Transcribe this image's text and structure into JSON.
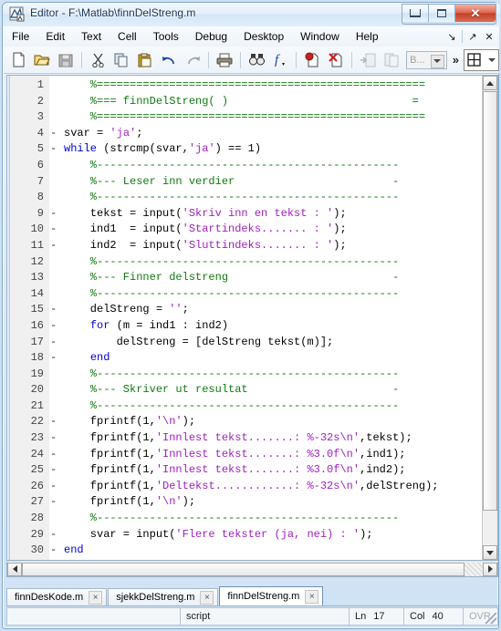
{
  "window": {
    "title": "Editor - F:\\Matlab\\finnDelStreng.m",
    "icon": "matlab-editor-icon",
    "minimize_label": "Minimize",
    "maximize_label": "Maximize",
    "close_label": "Close"
  },
  "menu": {
    "items": [
      {
        "label": "File"
      },
      {
        "label": "Edit"
      },
      {
        "label": "Text"
      },
      {
        "label": "Cell"
      },
      {
        "label": "Tools"
      },
      {
        "label": "Debug"
      },
      {
        "label": "Desktop"
      },
      {
        "label": "Window"
      },
      {
        "label": "Help"
      }
    ],
    "right": [
      {
        "name": "dock-arrow-icon",
        "glyph": "↘"
      },
      {
        "name": "undock-arrow-icon",
        "glyph": "↗"
      },
      {
        "name": "close-icon",
        "glyph": "✕"
      }
    ]
  },
  "toolbar": {
    "buttons": [
      {
        "name": "new-file-icon",
        "title": "New"
      },
      {
        "name": "open-file-icon",
        "title": "Open"
      },
      {
        "name": "save-icon",
        "title": "Save"
      },
      {
        "name": "cut-icon",
        "title": "Cut"
      },
      {
        "name": "copy-icon",
        "title": "Copy"
      },
      {
        "name": "paste-icon",
        "title": "Paste"
      },
      {
        "name": "undo-icon",
        "title": "Undo"
      },
      {
        "name": "redo-icon",
        "title": "Redo"
      },
      {
        "name": "print-icon",
        "title": "Print"
      },
      {
        "name": "find-icon",
        "title": "Find"
      },
      {
        "name": "function-browser-icon",
        "title": "Function"
      },
      {
        "name": "set-breakpoint-icon",
        "title": "Set/Clear Breakpoint"
      },
      {
        "name": "clear-breakpoints-icon",
        "title": "Clear All Breakpoints"
      },
      {
        "name": "step-in-icon",
        "title": "Step In"
      },
      {
        "name": "step-out-icon",
        "title": "Step Out"
      }
    ],
    "stack_dropdown_value": "B...",
    "overflow_label": "»",
    "layout_label": "Layout"
  },
  "editor": {
    "lines": [
      {
        "num": "1",
        "mark": "",
        "tokens": [
          {
            "t": "cm",
            "v": "    %=================================================="
          }
        ]
      },
      {
        "num": "2",
        "mark": "",
        "tokens": [
          {
            "t": "cm",
            "v": "    %=== finnDelStreng( )                            ="
          }
        ]
      },
      {
        "num": "3",
        "mark": "",
        "tokens": [
          {
            "t": "cm",
            "v": "    %=================================================="
          }
        ]
      },
      {
        "num": "4",
        "mark": "-",
        "tokens": [
          {
            "t": "pl",
            "v": "svar = "
          },
          {
            "t": "st",
            "v": "'ja'"
          },
          {
            "t": "pl",
            "v": ";"
          }
        ]
      },
      {
        "num": "5",
        "mark": "-",
        "tokens": [
          {
            "t": "kw",
            "v": "while"
          },
          {
            "t": "pl",
            "v": " (strcmp(svar,"
          },
          {
            "t": "st",
            "v": "'ja'"
          },
          {
            "t": "pl",
            "v": ") == 1)"
          }
        ]
      },
      {
        "num": "6",
        "mark": "",
        "tokens": [
          {
            "t": "cm",
            "v": "    %----------------------------------------------"
          }
        ]
      },
      {
        "num": "7",
        "mark": "",
        "tokens": [
          {
            "t": "cm",
            "v": "    %--- Leser inn verdier                        -"
          }
        ]
      },
      {
        "num": "8",
        "mark": "",
        "tokens": [
          {
            "t": "cm",
            "v": "    %----------------------------------------------"
          }
        ]
      },
      {
        "num": "9",
        "mark": "-",
        "tokens": [
          {
            "t": "pl",
            "v": "    tekst = input("
          },
          {
            "t": "st",
            "v": "'Skriv inn en tekst : '"
          },
          {
            "t": "pl",
            "v": ");"
          }
        ]
      },
      {
        "num": "10",
        "mark": "-",
        "tokens": [
          {
            "t": "pl",
            "v": "    ind1  = input("
          },
          {
            "t": "st",
            "v": "'Startindeks....... : '"
          },
          {
            "t": "pl",
            "v": ");"
          }
        ]
      },
      {
        "num": "11",
        "mark": "-",
        "tokens": [
          {
            "t": "pl",
            "v": "    ind2  = input("
          },
          {
            "t": "st",
            "v": "'Sluttindeks....... : '"
          },
          {
            "t": "pl",
            "v": ");"
          }
        ]
      },
      {
        "num": "12",
        "mark": "",
        "tokens": [
          {
            "t": "cm",
            "v": "    %----------------------------------------------"
          }
        ]
      },
      {
        "num": "13",
        "mark": "",
        "tokens": [
          {
            "t": "cm",
            "v": "    %--- Finner delstreng                         -"
          }
        ]
      },
      {
        "num": "14",
        "mark": "",
        "tokens": [
          {
            "t": "cm",
            "v": "    %----------------------------------------------"
          }
        ]
      },
      {
        "num": "15",
        "mark": "-",
        "tokens": [
          {
            "t": "pl",
            "v": "    delStreng = "
          },
          {
            "t": "st",
            "v": "''"
          },
          {
            "t": "pl",
            "v": ";"
          }
        ]
      },
      {
        "num": "16",
        "mark": "-",
        "tokens": [
          {
            "t": "pl",
            "v": "    "
          },
          {
            "t": "kw",
            "v": "for"
          },
          {
            "t": "pl",
            "v": " (m = ind1 : ind2)"
          }
        ]
      },
      {
        "num": "17",
        "mark": "-",
        "tokens": [
          {
            "t": "pl",
            "v": "        delStreng = [delStreng tekst(m)];"
          }
        ]
      },
      {
        "num": "18",
        "mark": "-",
        "tokens": [
          {
            "t": "pl",
            "v": "    "
          },
          {
            "t": "kw",
            "v": "end"
          }
        ]
      },
      {
        "num": "19",
        "mark": "",
        "tokens": [
          {
            "t": "cm",
            "v": "    %----------------------------------------------"
          }
        ]
      },
      {
        "num": "20",
        "mark": "",
        "tokens": [
          {
            "t": "cm",
            "v": "    %--- Skriver ut resultat                      -"
          }
        ]
      },
      {
        "num": "21",
        "mark": "",
        "tokens": [
          {
            "t": "cm",
            "v": "    %----------------------------------------------"
          }
        ]
      },
      {
        "num": "22",
        "mark": "-",
        "tokens": [
          {
            "t": "pl",
            "v": "    fprintf(1,"
          },
          {
            "t": "st",
            "v": "'\\n'"
          },
          {
            "t": "pl",
            "v": ");"
          }
        ]
      },
      {
        "num": "23",
        "mark": "-",
        "tokens": [
          {
            "t": "pl",
            "v": "    fprintf(1,"
          },
          {
            "t": "st",
            "v": "'Innlest tekst.......: %-32s\\n'"
          },
          {
            "t": "pl",
            "v": ",tekst);"
          }
        ]
      },
      {
        "num": "24",
        "mark": "-",
        "tokens": [
          {
            "t": "pl",
            "v": "    fprintf(1,"
          },
          {
            "t": "st",
            "v": "'Innlest tekst.......: %3.0f\\n'"
          },
          {
            "t": "pl",
            "v": ",ind1);"
          }
        ]
      },
      {
        "num": "25",
        "mark": "-",
        "tokens": [
          {
            "t": "pl",
            "v": "    fprintf(1,"
          },
          {
            "t": "st",
            "v": "'Innlest tekst.......: %3.0f\\n'"
          },
          {
            "t": "pl",
            "v": ",ind2);"
          }
        ]
      },
      {
        "num": "26",
        "mark": "-",
        "tokens": [
          {
            "t": "pl",
            "v": "    fprintf(1,"
          },
          {
            "t": "st",
            "v": "'Deltekst............: %-32s\\n'"
          },
          {
            "t": "pl",
            "v": ",delStreng);"
          }
        ]
      },
      {
        "num": "27",
        "mark": "-",
        "tokens": [
          {
            "t": "pl",
            "v": "    fprintf(1,"
          },
          {
            "t": "st",
            "v": "'\\n'"
          },
          {
            "t": "pl",
            "v": ");"
          }
        ]
      },
      {
        "num": "28",
        "mark": "",
        "tokens": [
          {
            "t": "cm",
            "v": "    %----------------------------------------------"
          }
        ]
      },
      {
        "num": "29",
        "mark": "-",
        "tokens": [
          {
            "t": "pl",
            "v": "    svar = input("
          },
          {
            "t": "st",
            "v": "'Flere tekster (ja, nei) : '"
          },
          {
            "t": "pl",
            "v": ");"
          }
        ]
      },
      {
        "num": "30",
        "mark": "-",
        "tokens": [
          {
            "t": "kw",
            "v": "end"
          }
        ]
      }
    ]
  },
  "tabs": [
    {
      "label": "finnDesKode.m",
      "active": false,
      "close": "×"
    },
    {
      "label": "sjekkDelStreng.m",
      "active": false,
      "close": "×"
    },
    {
      "label": "finnDelStreng.m",
      "active": true,
      "close": "×"
    }
  ],
  "status": {
    "file_type": "script",
    "line_label": "Ln",
    "line_value": "17",
    "col_label": "Col",
    "col_value": "40",
    "overwrite_label": "OVR"
  },
  "colors": {
    "comment": "#0f7a0f",
    "string": "#a020c0",
    "keyword": "#0000d0",
    "plain": "#000000",
    "title_text": "#14325c",
    "close_button": "#c1412a"
  }
}
